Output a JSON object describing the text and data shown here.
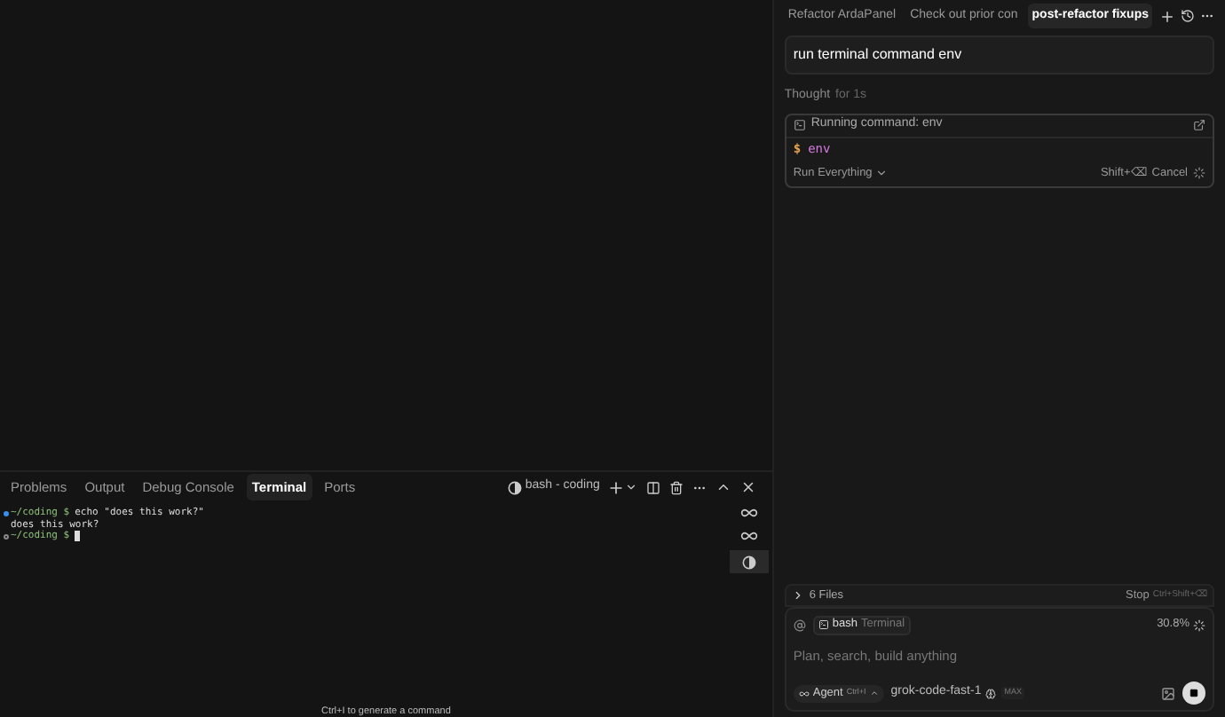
{
  "panel": {
    "tabs": [
      {
        "label": "Problems",
        "selected": false
      },
      {
        "label": "Output",
        "selected": false
      },
      {
        "label": "Debug Console",
        "selected": false
      },
      {
        "label": "Terminal",
        "selected": true
      },
      {
        "label": "Ports",
        "selected": false
      }
    ],
    "terminal_name": "bash - coding",
    "lines": [
      {
        "kind": "command",
        "prompt": "~/coding $",
        "text": "echo \"does this work?\""
      },
      {
        "kind": "output",
        "text": "does this work?"
      },
      {
        "kind": "prompt",
        "prompt": "~/coding $"
      }
    ],
    "hint": "Ctrl+I to generate a command"
  },
  "chat": {
    "tabs": [
      {
        "label": "Refactor ArdaPanel",
        "selected": false
      },
      {
        "label": "Check out prior con",
        "selected": false
      },
      {
        "label": "post-refactor fixups",
        "selected": true
      }
    ],
    "user_message": "run terminal command env",
    "thought": {
      "label": "Thought",
      "duration": "for 1s"
    },
    "command_card": {
      "title": "Running command: env",
      "prompt": "$",
      "command": "env",
      "mode": "Run Everything",
      "shortcut": "Shift+⌫",
      "cancel": "Cancel"
    },
    "files": {
      "label": "6 Files",
      "stop": "Stop",
      "shortcut": "Ctrl+Shift+⌫"
    },
    "composer": {
      "context_name": "bash",
      "context_kind": "Terminal",
      "usage": "30.8%",
      "placeholder": "Plan, search, build anything",
      "mode": "Agent",
      "mode_shortcut": "Ctrl+I",
      "model": "grok-code-fast-1",
      "max": "MAX"
    }
  }
}
